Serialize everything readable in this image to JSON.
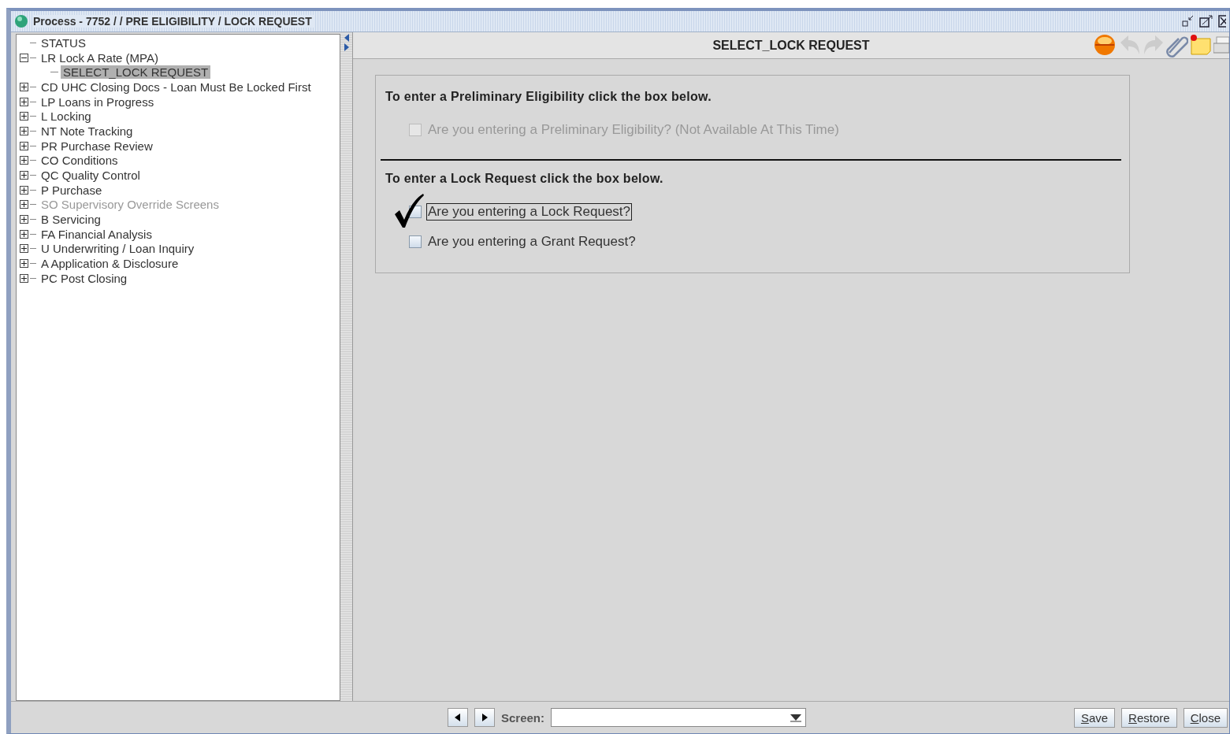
{
  "window": {
    "title": "Process - 7752 /  / PRE ELIGIBILITY / LOCK REQUEST"
  },
  "tree": [
    {
      "label": "STATUS",
      "kind": "leaf",
      "selected": false,
      "disabled": false
    },
    {
      "label": "LR Lock A Rate (MPA)",
      "kind": "node",
      "expanded": true,
      "selected": false,
      "disabled": false,
      "children": [
        {
          "label": "SELECT_LOCK REQUEST",
          "selected": true,
          "disabled": false
        }
      ]
    },
    {
      "label": "CD UHC Closing Docs - Loan Must Be Locked First",
      "kind": "node",
      "expanded": false,
      "selected": false,
      "disabled": false
    },
    {
      "label": "LP Loans in Progress",
      "kind": "node",
      "expanded": false,
      "selected": false,
      "disabled": false
    },
    {
      "label": "L Locking",
      "kind": "node",
      "expanded": false,
      "selected": false,
      "disabled": false
    },
    {
      "label": "NT Note Tracking",
      "kind": "node",
      "expanded": false,
      "selected": false,
      "disabled": false
    },
    {
      "label": "PR Purchase Review",
      "kind": "node",
      "expanded": false,
      "selected": false,
      "disabled": false
    },
    {
      "label": "CO Conditions",
      "kind": "node",
      "expanded": false,
      "selected": false,
      "disabled": false
    },
    {
      "label": "QC Quality Control",
      "kind": "node",
      "expanded": false,
      "selected": false,
      "disabled": false
    },
    {
      "label": "P Purchase",
      "kind": "node",
      "expanded": false,
      "selected": false,
      "disabled": false
    },
    {
      "label": "SO Supervisory Override Screens",
      "kind": "node",
      "expanded": false,
      "selected": false,
      "disabled": true
    },
    {
      "label": "B Servicing",
      "kind": "node",
      "expanded": false,
      "selected": false,
      "disabled": false
    },
    {
      "label": "FA Financial Analysis",
      "kind": "node",
      "expanded": false,
      "selected": false,
      "disabled": false
    },
    {
      "label": "U Underwriting / Loan Inquiry",
      "kind": "node",
      "expanded": false,
      "selected": false,
      "disabled": false
    },
    {
      "label": "A Application & Disclosure",
      "kind": "node",
      "expanded": false,
      "selected": false,
      "disabled": false
    },
    {
      "label": "PC Post Closing",
      "kind": "node",
      "expanded": false,
      "selected": false,
      "disabled": false
    }
  ],
  "content": {
    "title": "SELECT_LOCK REQUEST",
    "sections": [
      {
        "heading": "To enter a Preliminary Eligibility click the box below.",
        "options": [
          {
            "label": "Are you entering a Preliminary Eligibility? (Not Available At This Time)",
            "checked": false,
            "disabled": true,
            "focused": false
          }
        ]
      },
      {
        "heading": "To enter a Lock Request click the box below.",
        "options": [
          {
            "label": "Are you entering a Lock Request?",
            "checked": true,
            "disabled": false,
            "focused": true
          },
          {
            "label": "Are you entering a Grant Request?",
            "checked": false,
            "disabled": false,
            "focused": false
          }
        ]
      }
    ]
  },
  "footer": {
    "screen_label": "Screen:",
    "buttons": [
      "Save",
      "Restore",
      "Close"
    ]
  }
}
